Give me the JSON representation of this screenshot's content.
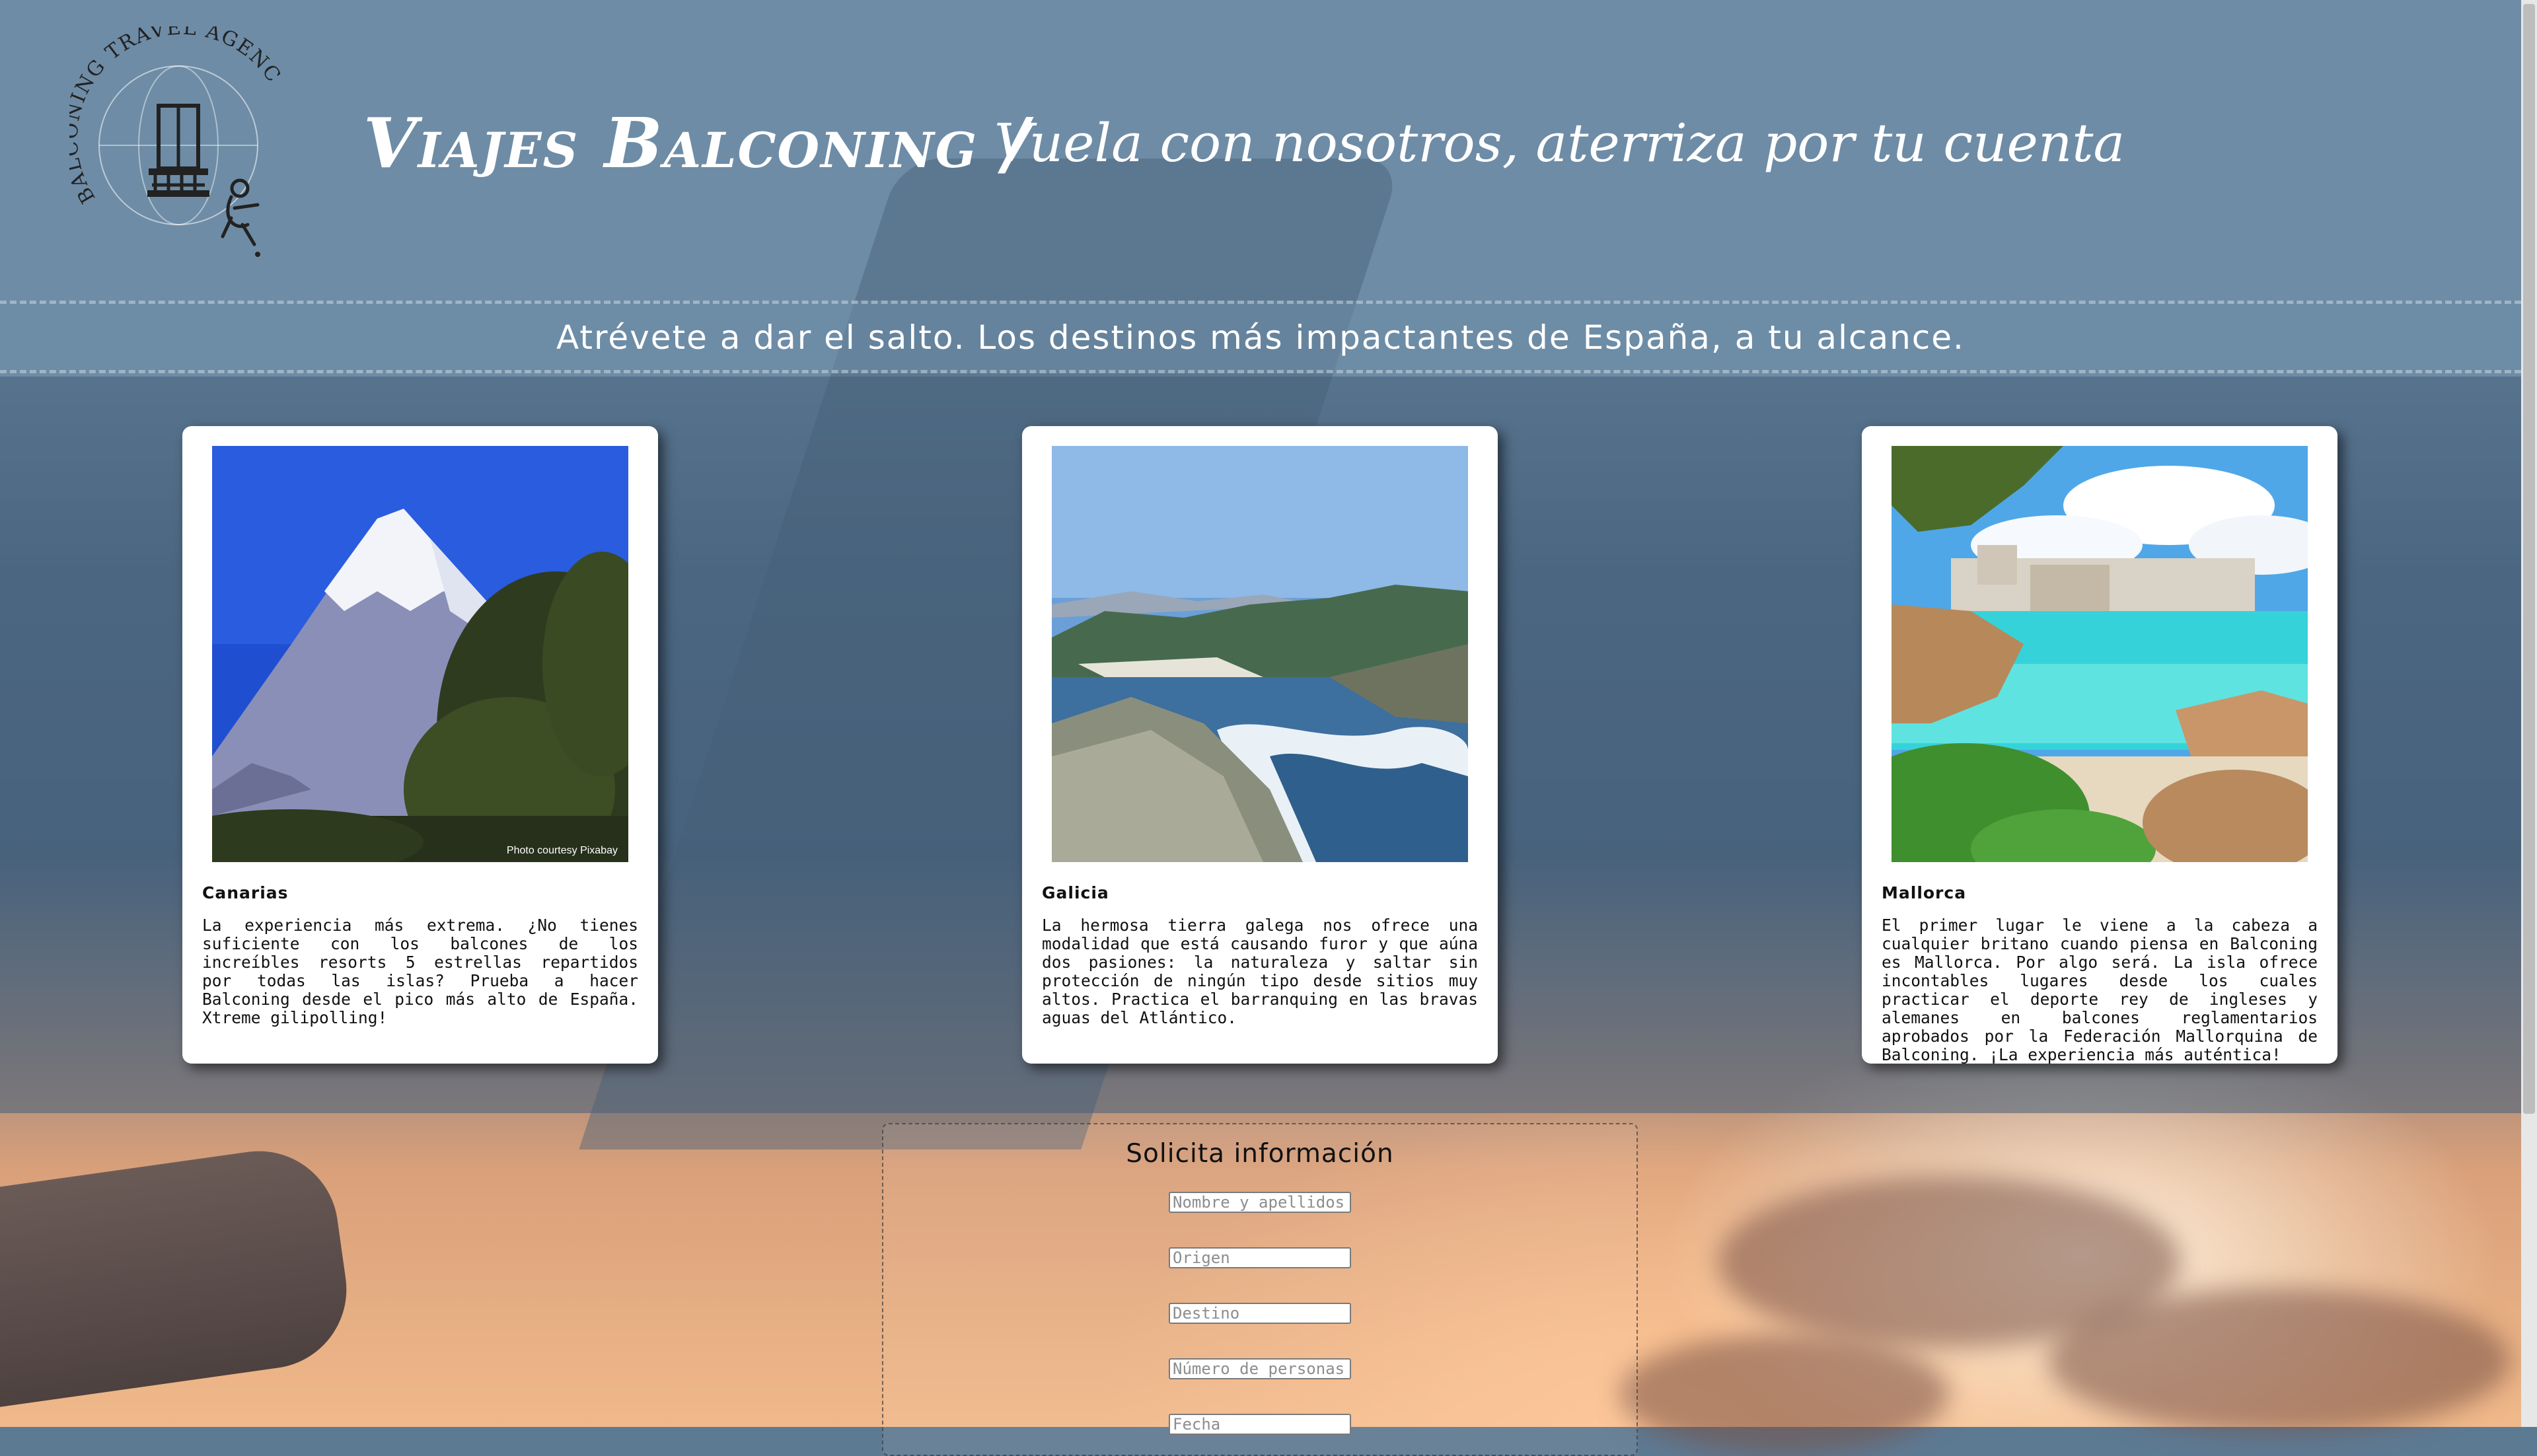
{
  "header": {
    "logo_text": "BALCONING TRAVEL AGENCY",
    "title": "Viajes Balconing /",
    "slogan": "Vuela con nosotros, aterriza por tu cuenta",
    "tagline": "Atrévete a dar el salto. Los destinos más impactantes de España, a tu alcance."
  },
  "destinations": [
    {
      "name": "Canarias",
      "photo_credit": "Photo courtesy Pixabay",
      "description": "La experiencia más extrema. ¿No tienes suficiente con los balcones de los increíbles resorts 5 estrellas repartidos por todas las islas? Prueba a hacer Balconing desde el pico más alto de España. Xtreme gilipolling!"
    },
    {
      "name": "Galicia",
      "description": "La hermosa tierra galega nos ofrece una modalidad que está causando furor y que aúna dos pasiones: la naturaleza y saltar sin protección de ningún tipo desde sitios muy altos. Practica el barranquing en las bravas aguas del Atlántico."
    },
    {
      "name": "Mallorca",
      "description": "El primer lugar le viene a la cabeza a cualquier britano cuando piensa en Balconing es Mallorca. Por algo será. La isla ofrece incontables lugares desde los cuales practicar el deporte rey de ingleses y alemanes en balcones reglamentarios aprobados por la Federación Mallorquina de Balconing. ¡La experiencia más auténtica!"
    }
  ],
  "form": {
    "title": "Solicita información",
    "fields": [
      {
        "placeholder": "Nombre y apellidos",
        "value": ""
      },
      {
        "placeholder": "Origen",
        "value": ""
      },
      {
        "placeholder": "Destino",
        "value": ""
      },
      {
        "placeholder": "Número de personas",
        "value": ""
      },
      {
        "placeholder": "Fecha",
        "value": ""
      }
    ]
  }
}
